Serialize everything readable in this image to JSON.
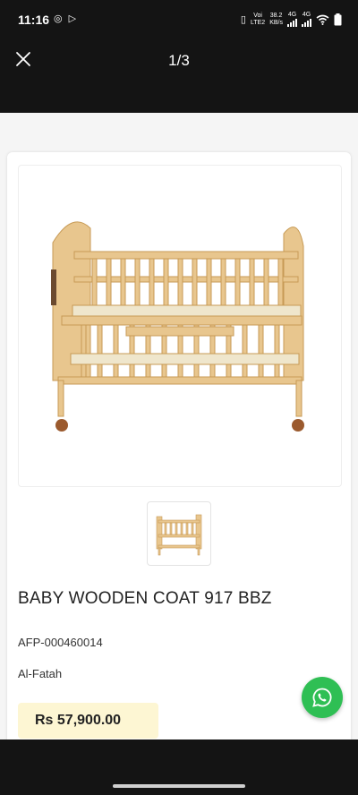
{
  "status_bar": {
    "time": "11:16",
    "network_labels": [
      "Voi",
      "LTE2"
    ],
    "speed": [
      "38.2",
      "KB/s"
    ],
    "sim_labels": [
      "4G",
      "4G"
    ]
  },
  "viewer": {
    "page_counter": "1/3"
  },
  "product": {
    "title": "BABY WOODEN COAT 917 BBZ",
    "sku": "AFP-000460014",
    "brand": "Al-Fatah",
    "price": "Rs 57,900.00",
    "image_alt": "wooden-baby-crib"
  },
  "colors": {
    "whatsapp": "#2fbf54",
    "price_badge": "#fdf6d3",
    "wood": "#e6c48a"
  }
}
